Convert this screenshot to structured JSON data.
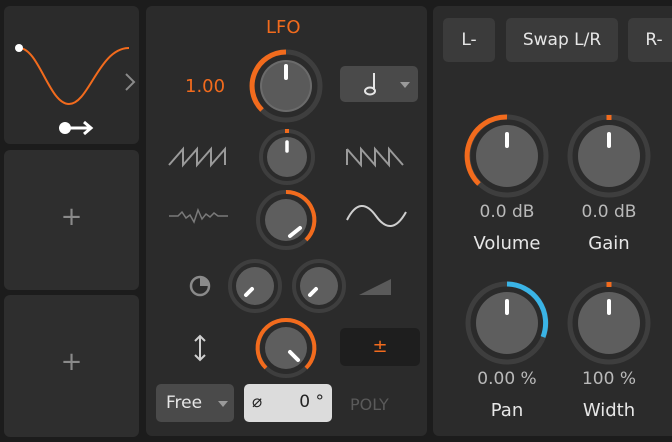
{
  "lfo": {
    "title": "LFO",
    "rate_value": "1.00",
    "note_icon": "quarter-note-icon",
    "mode_label": "Free",
    "phase_symbol": "⌀",
    "phase_value": "0 °",
    "poly_label": "POLY",
    "bipolar_symbol": "±"
  },
  "router": {
    "buttons": [
      "L-",
      "Swap L/R",
      "R-"
    ],
    "knobs": [
      {
        "label": "Volume",
        "value": "0.0 dB"
      },
      {
        "label": "Gain",
        "value": "0.0 dB"
      },
      {
        "label": "Pan",
        "value": "0.00 %"
      },
      {
        "label": "Width",
        "value": "100 %"
      }
    ]
  },
  "slots": {
    "add_symbol": "+"
  },
  "colors": {
    "accent_orange": "#f26b1d",
    "pan_blue": "#3ab4e6",
    "panel_bg": "#2b2b2b"
  }
}
